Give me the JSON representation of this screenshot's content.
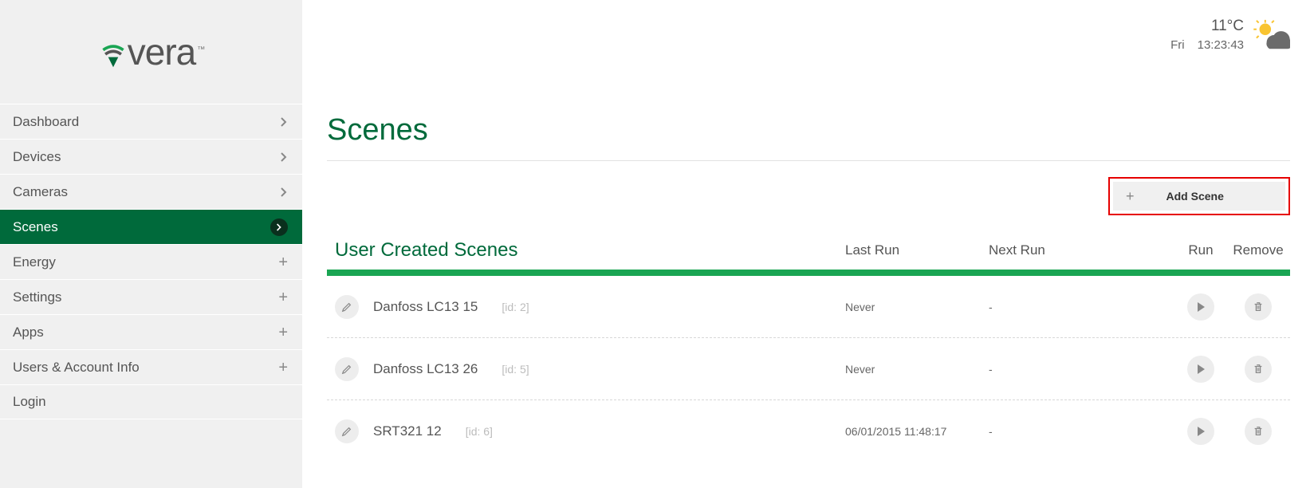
{
  "brand": {
    "name": "vera",
    "tm": "™"
  },
  "sidebar": {
    "items": [
      {
        "label": "Dashboard",
        "icon": "chevron"
      },
      {
        "label": "Devices",
        "icon": "chevron"
      },
      {
        "label": "Cameras",
        "icon": "chevron"
      },
      {
        "label": "Scenes",
        "icon": "chevron",
        "active": true
      },
      {
        "label": "Energy",
        "icon": "plus"
      },
      {
        "label": "Settings",
        "icon": "plus"
      },
      {
        "label": "Apps",
        "icon": "plus"
      },
      {
        "label": "Users & Account Info",
        "icon": "plus"
      },
      {
        "label": "Login",
        "icon": ""
      }
    ]
  },
  "topbar": {
    "temperature": "11°C",
    "day": "Fri",
    "time": "13:23:43"
  },
  "page": {
    "title": "Scenes",
    "add_scene_label": "Add Scene"
  },
  "table": {
    "section_title": "User Created Scenes",
    "col_last": "Last Run",
    "col_next": "Next Run",
    "col_run": "Run",
    "col_remove": "Remove",
    "rows": [
      {
        "name": "Danfoss LC13 15",
        "id": "[id: 2]",
        "last": "Never",
        "next": "-"
      },
      {
        "name": "Danfoss LC13 26",
        "id": "[id: 5]",
        "last": "Never",
        "next": "-"
      },
      {
        "name": "SRT321 12",
        "id": "[id: 6]",
        "last": "06/01/2015 11:48:17",
        "next": "-"
      }
    ]
  }
}
